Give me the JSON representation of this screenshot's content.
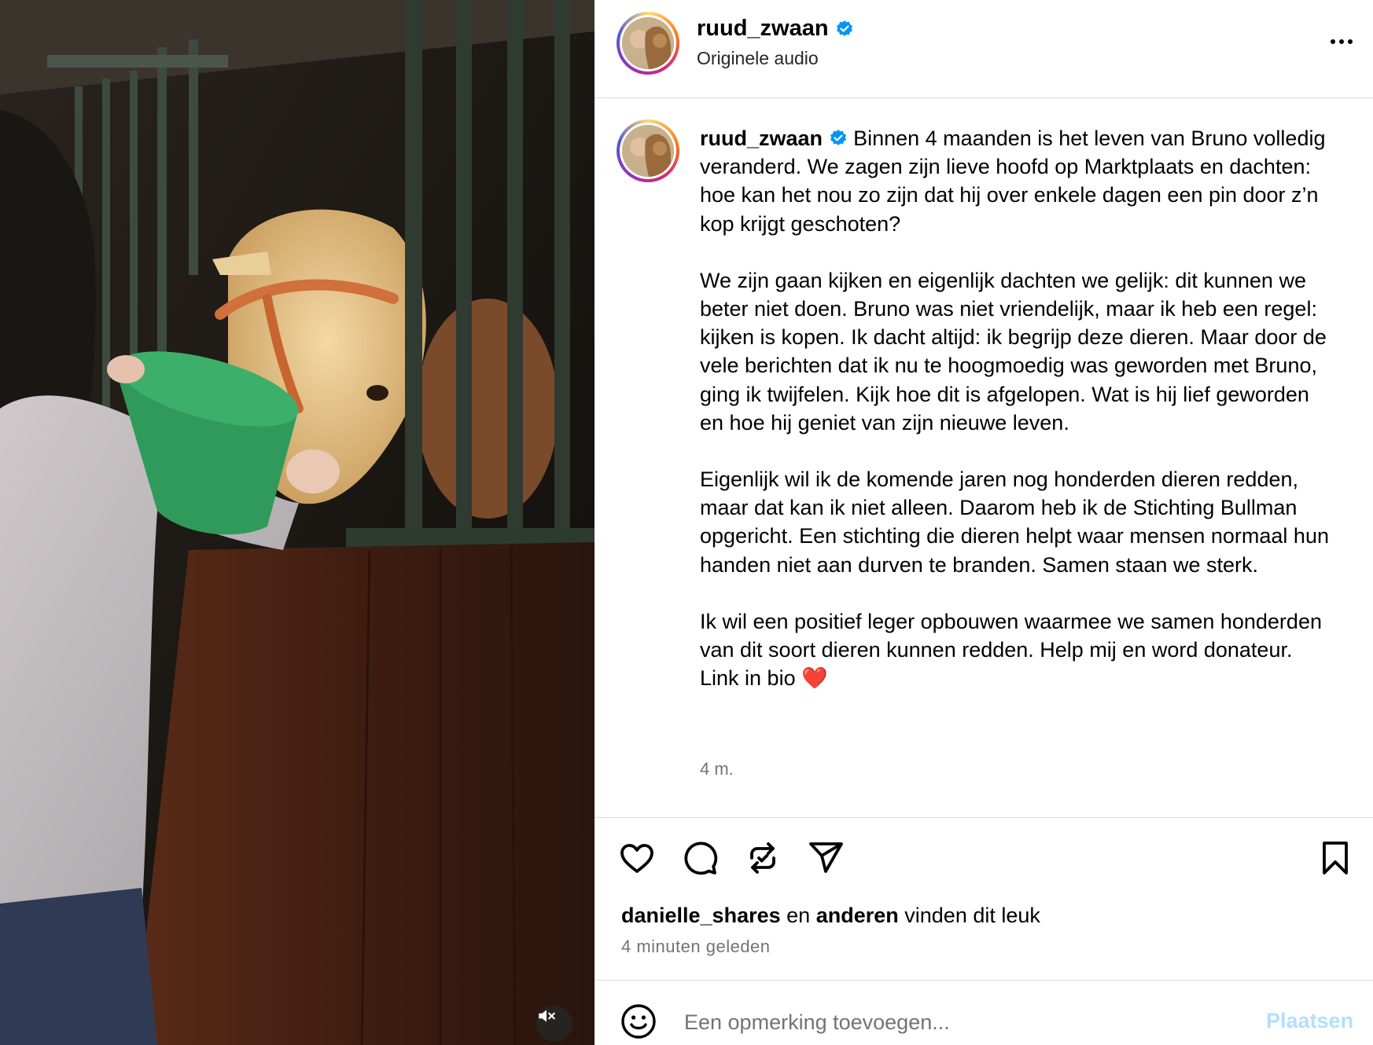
{
  "media": {
    "mute_icon": "speaker-muted-icon"
  },
  "header": {
    "username": "ruud_zwaan",
    "audio_label": "Originele audio",
    "more_icon": "more-horizontal-icon"
  },
  "caption": {
    "username": "ruud_zwaan",
    "paragraphs": [
      "Binnen 4 maanden is het leven van Bruno volledig veranderd. We zagen zijn lieve hoofd op Marktplaats en dachten: hoe kan het nou zo zijn dat hij over enkele dagen een pin door z’n kop krijgt geschoten?",
      "We zijn gaan kijken en eigenlijk dachten we gelijk: dit kunnen we beter niet doen. Bruno was niet vriendelijk, maar ik heb een regel: kijken is kopen. Ik dacht altijd: ik begrijp deze dieren. Maar door de vele berichten dat ik nu te hoogmoedig was geworden met Bruno, ging ik twijfelen. Kijk hoe dit is afgelopen. Wat is hij lief geworden en hoe hij geniet van zijn nieuwe leven.",
      "Eigenlijk wil ik de komende jaren nog honderden dieren redden, maar dat kan ik niet alleen. Daarom heb ik de Stichting Bullman opgericht. Een stichting die dieren helpt waar mensen normaal hun handen niet aan durven te branden. Samen staan we sterk.",
      "Ik wil een positief leger opbouwen waarmee we samen honderden van dit soort dieren kunnen redden. Help mij en word donateur. Link in bio ❤️"
    ],
    "time": "4 m."
  },
  "actions": {
    "like_icon": "heart-icon",
    "comment_icon": "comment-icon",
    "repost_icon": "repost-icon",
    "share_icon": "share-icon",
    "save_icon": "bookmark-icon"
  },
  "likes": {
    "user": "danielle_shares",
    "connector": "en",
    "others": "anderen",
    "suffix": "vinden dit leuk"
  },
  "posted_ago": "4 minuten geleden",
  "comment": {
    "placeholder": "Een opmerking toevoegen...",
    "post_label": "Plaatsen",
    "emoji_icon": "emoji-icon"
  },
  "colors": {
    "verified": "#0095f6",
    "post_disabled": "#b2dffc",
    "secondary_text": "#737373"
  }
}
